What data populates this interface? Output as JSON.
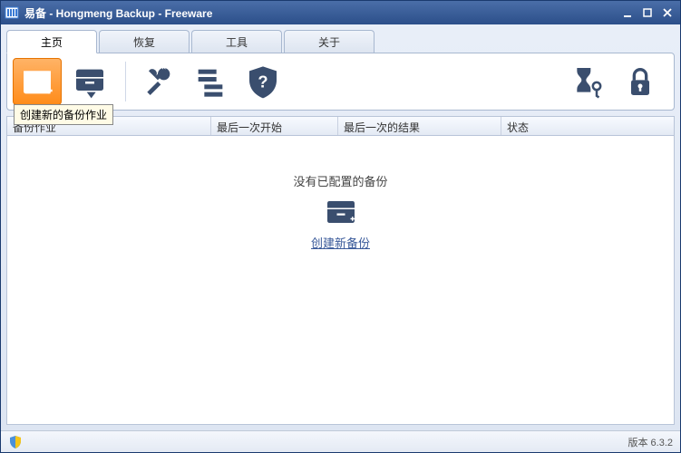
{
  "title": "易备 - Hongmeng Backup - Freeware",
  "tabs": {
    "home": "主页",
    "restore": "恢复",
    "tools": "工具",
    "about": "关于"
  },
  "tooltip": {
    "new_backup": "创建新的备份作业"
  },
  "columns": {
    "job": "备份作业",
    "last_start": "最后一次开始",
    "last_result": "最后一次的结果",
    "status": "状态"
  },
  "empty": {
    "message": "没有已配置的备份",
    "link": "创建新备份"
  },
  "footer": {
    "version": "版本 6.3.2"
  }
}
